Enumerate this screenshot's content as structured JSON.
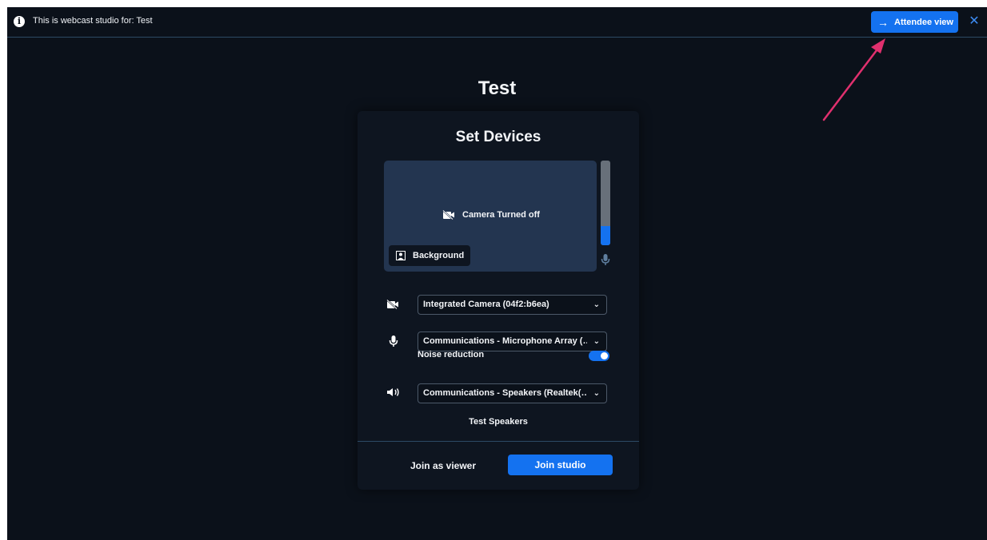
{
  "banner": {
    "info_icon": "info-icon",
    "text": "This is webcast studio for: Test",
    "attendee_view_label": "Attendee view",
    "attendee_view_icon": "arrow-right-icon",
    "close_icon": "close-icon"
  },
  "event_title": "Test",
  "setup": {
    "title": "Set Devices",
    "preview": {
      "status_text": "Camera Turned off",
      "status_icon": "camera-off-icon",
      "background_label": "Background",
      "background_icon": "background-icon",
      "mic_level_fraction": 0.23
    },
    "camera": {
      "icon": "camera-off-icon",
      "value": "Integrated Camera (04f2:b6ea)"
    },
    "microphone": {
      "icon": "microphone-icon",
      "value": "Communications - Microphone Array (…",
      "noise_reduction_label": "Noise reduction",
      "noise_reduction_on": true
    },
    "speakers": {
      "icon": "speaker-icon",
      "value": "Communications - Speakers (Realtek(…",
      "test_label": "Test Speakers"
    },
    "join_viewer_label": "Join as viewer",
    "join_studio_label": "Join studio"
  },
  "colors": {
    "accent": "#1472f0",
    "background": "#0b111a",
    "preview": "#233550",
    "annotation_arrow": "#e0306e"
  }
}
